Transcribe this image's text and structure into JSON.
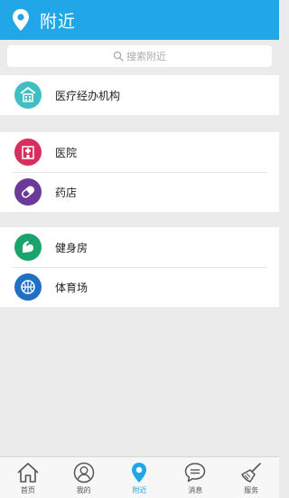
{
  "header": {
    "title": "附近",
    "icon": "location-pin-icon"
  },
  "search": {
    "placeholder": "搜索附近"
  },
  "groups": [
    {
      "items": [
        {
          "label": "医疗经办机构",
          "icon": "institution-building-icon",
          "color": "#3fbfc4"
        }
      ]
    },
    {
      "items": [
        {
          "label": "医院",
          "icon": "hospital-icon",
          "color": "#d62f5f"
        },
        {
          "label": "药店",
          "icon": "pill-icon",
          "color": "#6b3a99"
        }
      ]
    },
    {
      "items": [
        {
          "label": "健身房",
          "icon": "muscle-arm-icon",
          "color": "#1aa36b"
        },
        {
          "label": "体育场",
          "icon": "ball-icon",
          "color": "#1f6fc4"
        }
      ]
    }
  ],
  "tabbar": {
    "items": [
      {
        "label": "首页",
        "icon": "home-icon",
        "active": false
      },
      {
        "label": "我的",
        "icon": "user-icon",
        "active": false
      },
      {
        "label": "附近",
        "icon": "location-pin-icon",
        "active": true
      },
      {
        "label": "消息",
        "icon": "chat-bubble-icon",
        "active": false
      },
      {
        "label": "服务",
        "icon": "broom-icon",
        "active": false
      }
    ]
  },
  "colors": {
    "accent": "#21a7e8",
    "background": "#ebebeb"
  }
}
